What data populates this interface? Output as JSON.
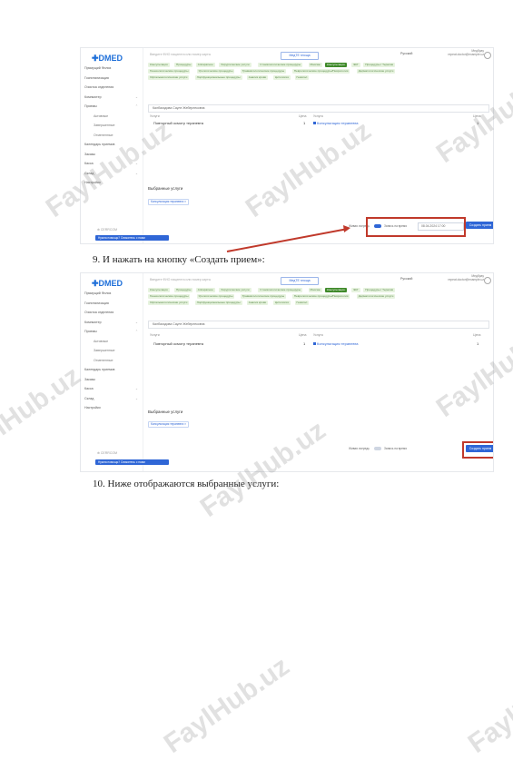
{
  "app": {
    "logo_text": "DMED",
    "search_placeholder": "Введите ФИО пациента или номер карты",
    "module_label": "МедТЕ площа",
    "language": "Русский",
    "user_name": "Медбрау",
    "user_email": "repeat.doctor@example.uz",
    "sidebar": [
      {
        "label": "Прямущий Филиз",
        "arrow": ""
      },
      {
        "label": "Госпитализация",
        "arrow": ""
      },
      {
        "label": "Очистка отделения",
        "arrow": ""
      },
      {
        "label": "Компьютер",
        "arrow": "⌄"
      },
      {
        "label": "Приемы",
        "arrow": "⌃"
      },
      {
        "label": "Активные",
        "sub": true
      },
      {
        "label": "Завершенные",
        "sub": true
      },
      {
        "label": "Отмененные",
        "sub": true
      },
      {
        "label": "Календарь приемов",
        "arrow": ""
      },
      {
        "label": "Заказы",
        "arrow": ""
      },
      {
        "label": "Касса",
        "arrow": "⌄"
      },
      {
        "label": "Склад",
        "arrow": "⌄"
      },
      {
        "label": "Настройки",
        "arrow": ""
      }
    ],
    "sidebar_footer": "⊕ CERRCOM",
    "sidebar_button": "Нужна помощь? Свяжитесь с нами",
    "categories_row1": [
      "Консультация",
      "Процедуры",
      "Аппаратное",
      "Хирургические услуги",
      "Стоматологические процедуры",
      "Массаж",
      "Консультация",
      "ЭКГ",
      "Процедуры / Терапия"
    ],
    "categories_row2": [
      "Гинекологические процедуры",
      "Урологические процедуры",
      "Травматологические процедуры",
      "Неврологические процедуры/Неврология",
      "Дерматологические услуги"
    ],
    "categories_row3": [
      "Офтальмологические услуги",
      "Лор/функциональные процедуры",
      "Анализ крови",
      "Цитология",
      "Гематол"
    ],
    "active_category_index": 6,
    "patient_field": "Калбахадова Сауле Жеберлековна",
    "table_headers": {
      "left_col": "Услуги",
      "price": "Цена",
      "right_col": "Услуга",
      "price2": "Цена"
    },
    "row": {
      "service": "Повторный осмотр терапевта",
      "count": "1",
      "selected_service": "Консультация терапевта",
      "price": "1"
    },
    "selected_title": "Выбранные услуги",
    "selected_chip": "Консультация терапевта ×",
    "footer_label1": "Живая очередь",
    "footer_label2": "Запись на время",
    "date_value": "08.04.2024 17:00",
    "create_button": "Создать прием"
  },
  "captions": {
    "step9": "9.   И нажать на кнопку «Создать прием»:",
    "step10": "10. Ниже отображаются выбранные услуги:"
  },
  "watermark": "FaylHub.uz",
  "colors": {
    "accent": "#2f66d6",
    "highlight": "#c0392b",
    "active_category": "#3f8a2a"
  }
}
